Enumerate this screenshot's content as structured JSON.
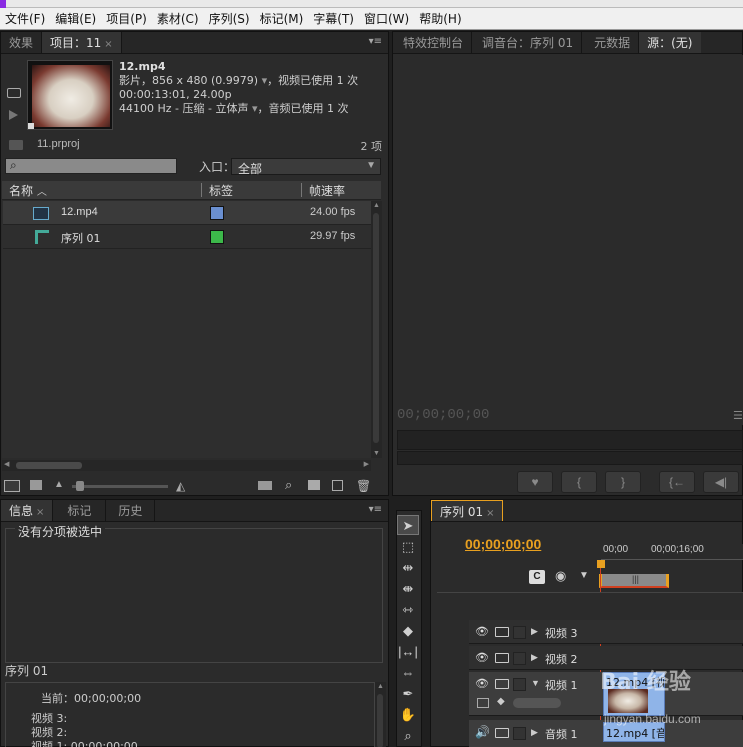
{
  "menubar": {
    "items": [
      "文件(F)",
      "编辑(E)",
      "项目(P)",
      "素材(C)",
      "序列(S)",
      "标记(M)",
      "字幕(T)",
      "窗口(W)",
      "帮助(H)"
    ]
  },
  "project_panel": {
    "tabs": [
      "效果",
      "项目：11"
    ],
    "clip": {
      "name": "12.mp4",
      "line1": "影片，856 x 480 (0.9979)",
      "line1_tail": "，视频已使用 1 次",
      "line2": "00:00:13:01, 24.00p",
      "line3": "44100 Hz - 压缩 - 立体声",
      "line3_tail": "，音频已使用 1 次"
    },
    "project_file": "11.prproj",
    "item_count": "2 项",
    "in_label": "入口：",
    "in_value": "全部",
    "search_placeholder": "",
    "columns": {
      "name": "名称",
      "label": "标签",
      "fps": "帧速率"
    },
    "items": [
      {
        "name": "12.mp4",
        "fps": "24.00 fps",
        "color": "#6a8fd0"
      },
      {
        "name": "序列 01",
        "fps": "29.97 fps",
        "color": "#3cb84a"
      }
    ]
  },
  "source_panel": {
    "tabs": [
      "特效控制台",
      "调音台：序列 01",
      "元数据",
      "源：(无)"
    ],
    "timecode": "00;00;00;00",
    "buttons": [
      "marker",
      "in",
      "out",
      "goto-in",
      "step-back"
    ]
  },
  "info_panel": {
    "tabs": [
      "信息",
      "标记",
      "历史"
    ],
    "no_selection": "没有分项被选中",
    "sequence_label": "序列 01",
    "current": "当前：00;00;00;00",
    "tracks": [
      "视频 3:",
      "视频 2:",
      "视频 1: 00;00;00;00"
    ]
  },
  "tools": [
    "selection",
    "track-select",
    "ripple-edit",
    "rolling-edit",
    "rate-stretch",
    "razor",
    "slip",
    "slide",
    "pen",
    "hand",
    "zoom"
  ],
  "timeline": {
    "tab": "序列 01",
    "timecode": "00;00;00;00",
    "ruler": [
      "00;00",
      "00;00;16;00"
    ],
    "tracks": [
      {
        "name": "视频 3"
      },
      {
        "name": "视频 2"
      },
      {
        "name": "视频 1",
        "clip": "12.mp4 [视"
      },
      {
        "name": "音频 1",
        "clip": "12.mp4 [音"
      }
    ]
  },
  "watermark": {
    "brand": "Bai 经验",
    "url": "jingyan.baidu.com"
  },
  "colors": {
    "accent": "#e8a020",
    "playhead": "#d04020",
    "clip_video": "#8fb4e8",
    "clip_audio": "#8fb4e8"
  }
}
